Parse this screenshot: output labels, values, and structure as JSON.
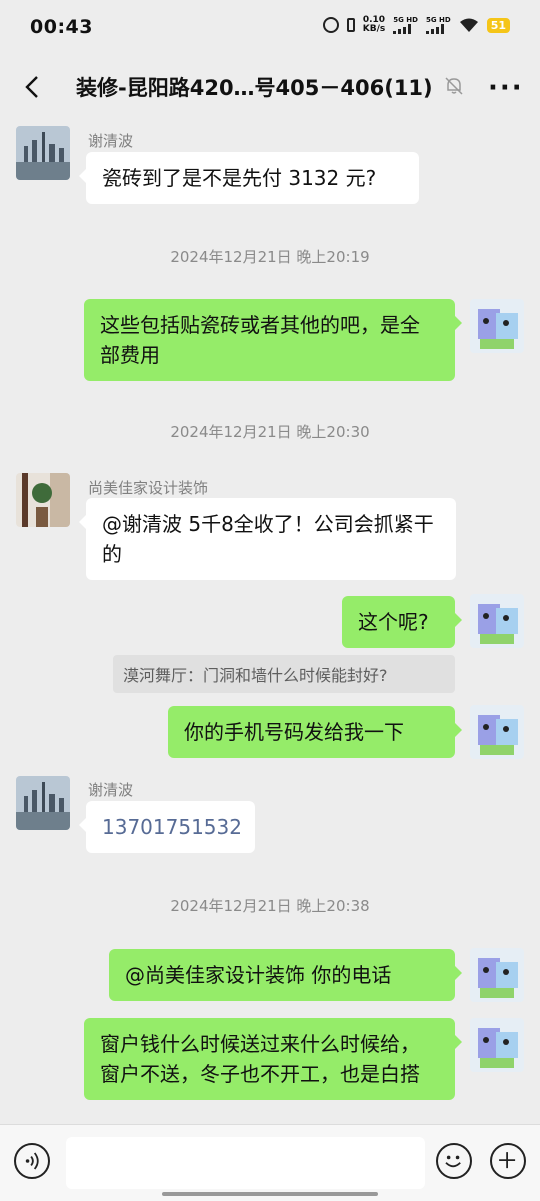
{
  "status_bar": {
    "time": "00:43",
    "speed_value": "0.10",
    "speed_unit": "KB/s",
    "sim1_label": "5G HD",
    "sim2_label": "5G HD",
    "battery": "51"
  },
  "header": {
    "title": "装修-昆阳路420…号405－406(11)"
  },
  "messages": [
    {
      "type": "incoming",
      "sender": "谢清波",
      "text": "瓷砖到了是不是先付 3132 元?"
    },
    {
      "type": "timestamp",
      "text": "2024年12月21日 晚上20:19"
    },
    {
      "type": "outgoing",
      "text": "这些包括贴瓷砖或者其他的吧，是全部费用"
    },
    {
      "type": "timestamp",
      "text": "2024年12月21日 晚上20:30"
    },
    {
      "type": "incoming",
      "sender": "尚美佳家设计装饰",
      "text": "@谢清波 5千8全收了！公司会抓紧干的"
    },
    {
      "type": "outgoing",
      "text": "这个呢?",
      "quote": "漠河舞厅：门洞和墙什么时候能封好?"
    },
    {
      "type": "outgoing",
      "text": "你的手机号码发给我一下"
    },
    {
      "type": "incoming",
      "sender": "谢清波",
      "text": "13701751532"
    },
    {
      "type": "timestamp",
      "text": "2024年12月21日 晚上20:38"
    },
    {
      "type": "outgoing",
      "text": "@尚美佳家设计装饰  你的电话"
    },
    {
      "type": "outgoing",
      "text": "窗户钱什么时候送过来什么时候给，窗户不送，冬子也不开工，也是白搭"
    }
  ]
}
